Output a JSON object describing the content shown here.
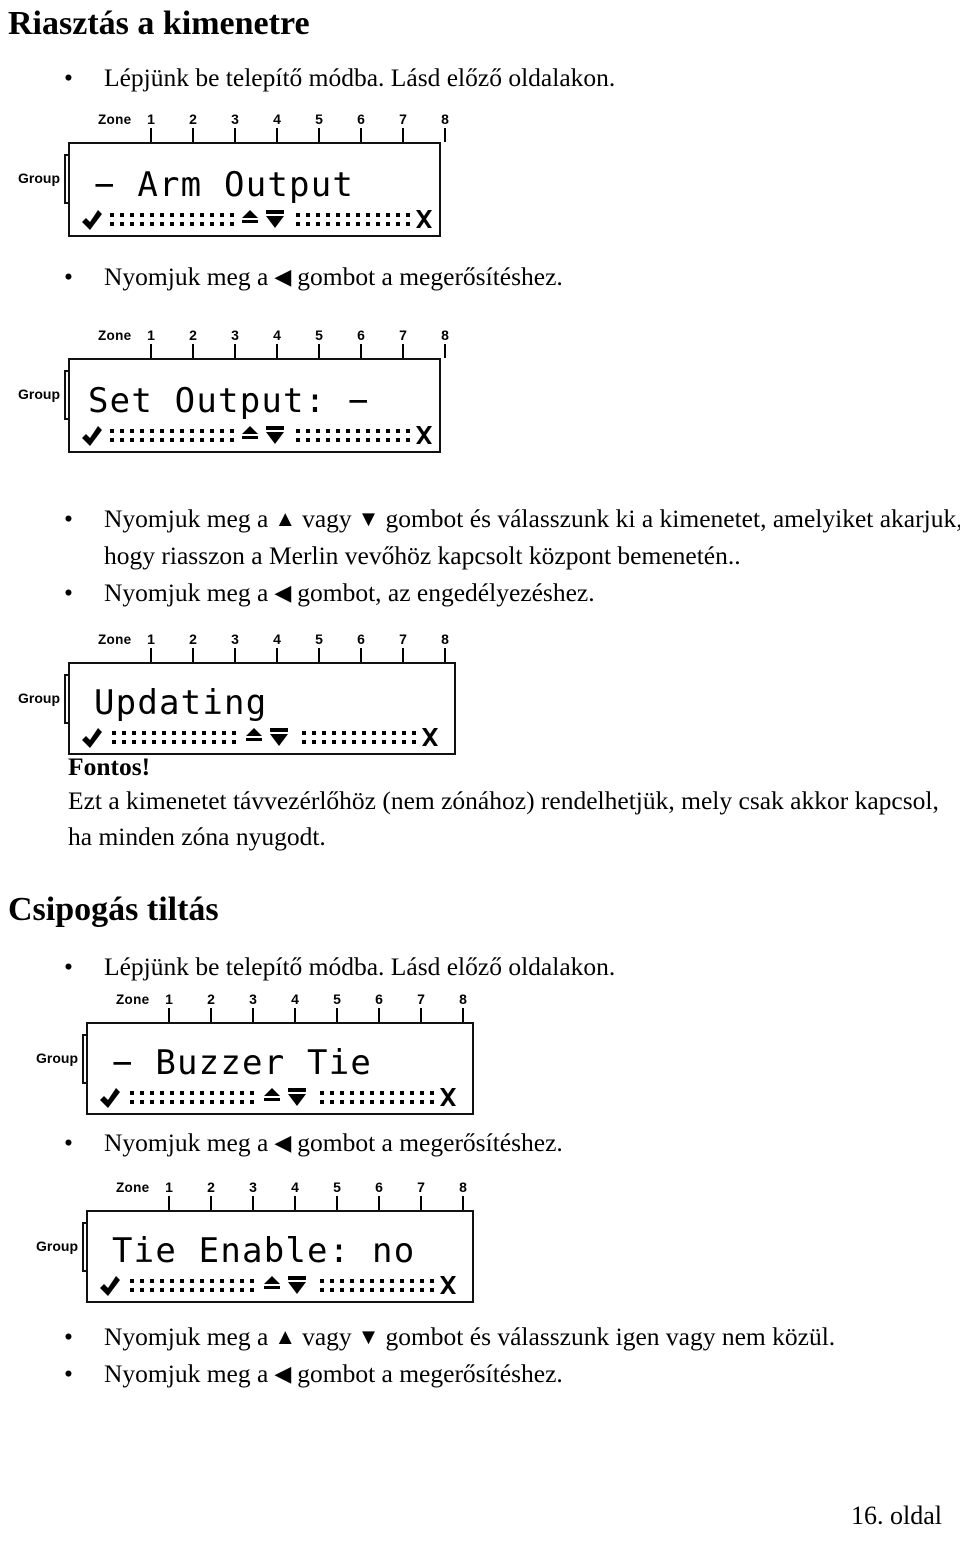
{
  "document": {
    "page_footer": "16. oldal"
  },
  "sections": [
    {
      "heading": "Riasztás a kimenetre",
      "bullets_before": [
        "Lépjünk be telepítő módba. Lásd előző oldalakon."
      ]
    },
    {
      "heading": "Csipogás tiltás"
    }
  ],
  "headings": {
    "alarm_output": "Riasztás a kimenetre",
    "buzzer_disable": "Csipogás tiltás"
  },
  "bullets": {
    "enter_installer_mode": "Lépjünk be telepítő módba. Lásd előző oldalakon.",
    "press_left_confirm": {
      "pre": "Nyomjuk meg a",
      "icon": "left-arrow",
      "post": "gombot a megerősítéshez."
    },
    "select_output": {
      "pre": "Nyomjuk meg a",
      "icon_up": "up-arrow",
      "mid": "vagy",
      "icon_down": "down-arrow",
      "post_line1": "gombot és válasszunk ki a kimenetet, amelyiket akarjuk,",
      "post_line2": "hogy riasszon a Merlin vevőhöz kapcsolt központ bemenetén.."
    },
    "press_left_enable": {
      "pre": "Nyomjuk meg a",
      "icon": "left-arrow",
      "post": "gombot, az engedélyezéshez."
    },
    "enter_installer_mode_2": "Lépjünk be telepítő módba. Lásd előző oldalakon.",
    "press_left_confirm_2": {
      "pre": "Nyomjuk meg a",
      "icon": "left-arrow",
      "post": "gombot a megerősítéshez."
    },
    "select_yes_no": {
      "pre": "Nyomjuk meg a",
      "icon_up": "up-arrow",
      "mid": "vagy",
      "icon_down": "down-arrow",
      "post": "gombot és válasszunk igen vagy nem közül."
    },
    "press_left_confirm_3": {
      "pre": "Nyomjuk meg a",
      "icon": "left-arrow",
      "post": "gombot a megerősítéshez."
    }
  },
  "note": {
    "title": "Fontos!",
    "line1": "Ezt a kimenetet távvezérlőhöz (nem zónához) rendelhetjük, mely csak akkor kapcsol,",
    "line2": "ha minden zóna nyugodt."
  },
  "lcd_common": {
    "zone_label": "Zone",
    "zone_numbers": [
      "1",
      "2",
      "3",
      "4",
      "5",
      "6",
      "7",
      "8"
    ],
    "group_label": "Group",
    "status_left_icon": "check-mark",
    "status_right_icon": "cross-mark",
    "status_center_icons": [
      "up-arrow-solid",
      "down-arrow-solid"
    ]
  },
  "lcd_displays": [
    {
      "id": "lcd-arm-output",
      "line1": "- Arm Output",
      "line2_icons": "check dots up down dots cross"
    },
    {
      "id": "lcd-set-output",
      "line1": "Set Output: -",
      "line2_icons": "check dots up down dots cross"
    },
    {
      "id": "lcd-updating",
      "line1": "Updating",
      "line2_icons": "check dots up down dots cross"
    },
    {
      "id": "lcd-buzzer-tie",
      "line1": "- Buzzer Tie",
      "line2_icons": "check dots up down dots cross"
    },
    {
      "id": "lcd-tie-enable",
      "line1": "Tie Enable: no",
      "line2_icons": "check dots up down dots cross"
    }
  ],
  "colors": {
    "text": "#000000",
    "frame": "#111111",
    "background": "#ffffff"
  }
}
